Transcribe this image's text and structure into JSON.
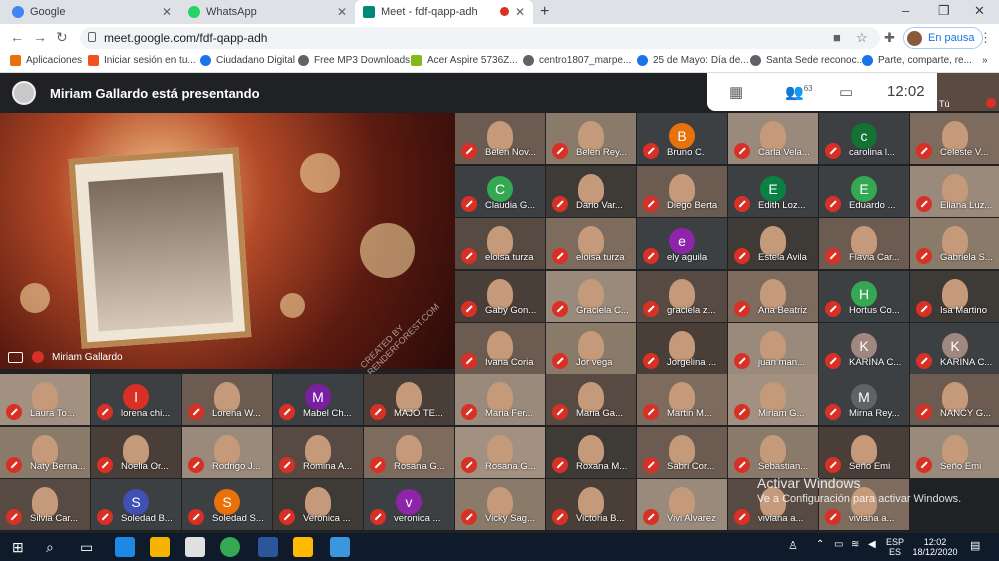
{
  "browser": {
    "tabs": [
      {
        "label": "Google",
        "icon": "google-icon",
        "color": "#4285f4"
      },
      {
        "label": "WhatsApp",
        "icon": "whatsapp-icon",
        "color": "#25d366"
      },
      {
        "label": "Meet - fdf-qapp-adh",
        "icon": "meet-icon",
        "color": "#00897b"
      }
    ],
    "url": "meet.google.com/fdf-qapp-adh",
    "profile_status": "En pausa",
    "bookmarks": [
      "Aplicaciones",
      "Iniciar sesión en tu...",
      "Ciudadano Digital",
      "Free MP3 Downloads",
      "Acer Aspire 5736Z...",
      "centro1807_marpe...",
      "25 de Mayo: Día de...",
      "Santa Sede reconoc...",
      "Parte, comparte, re..."
    ]
  },
  "meet": {
    "presenting_text": "Miriam Gallardo está presentando",
    "participants_count": "63",
    "clock": "12:02",
    "self_label": "Tú",
    "presenter_name": "Miriam Gallardo",
    "watermark": "CREATED BY RENDERFOREST.COM",
    "accent_red": "#d93025"
  },
  "participants": [
    {
      "name": "Belen Nov...",
      "letter": ""
    },
    {
      "name": "Belen Rey...",
      "letter": ""
    },
    {
      "name": "Bruno C.",
      "letter": "B",
      "color": "#e8710a"
    },
    {
      "name": "Carla Vela...",
      "letter": ""
    },
    {
      "name": "carolina l...",
      "letter": "c",
      "color": "#137333"
    },
    {
      "name": "Celeste V...",
      "letter": ""
    },
    {
      "name": "Claudia G...",
      "letter": "C",
      "color": "#34a853"
    },
    {
      "name": "Dario Var...",
      "letter": ""
    },
    {
      "name": "Diego Berta",
      "letter": ""
    },
    {
      "name": "Edith Loz...",
      "letter": "E",
      "color": "#0b8043"
    },
    {
      "name": "Eduardo ...",
      "letter": "E",
      "color": "#34a853"
    },
    {
      "name": "Eliana Luz...",
      "letter": ""
    },
    {
      "name": "eloisa turza",
      "letter": ""
    },
    {
      "name": "eloisa turza",
      "letter": ""
    },
    {
      "name": "ely aguila",
      "letter": "e",
      "color": "#8e24aa"
    },
    {
      "name": "Estela Avila",
      "letter": ""
    },
    {
      "name": "Flavia Car...",
      "letter": ""
    },
    {
      "name": "Gabriela S...",
      "letter": ""
    },
    {
      "name": "Gaby Gon...",
      "letter": ""
    },
    {
      "name": "Graciela C...",
      "letter": ""
    },
    {
      "name": "graciela z...",
      "letter": ""
    },
    {
      "name": "Ana Beatriz",
      "letter": ""
    },
    {
      "name": "Hortus Co...",
      "letter": "H",
      "color": "#34a853"
    },
    {
      "name": "Isa Martino",
      "letter": ""
    },
    {
      "name": "Ivana Coria",
      "letter": ""
    },
    {
      "name": "Jor vega",
      "letter": ""
    },
    {
      "name": "Jorgelina ...",
      "letter": ""
    },
    {
      "name": "juan man...",
      "letter": ""
    },
    {
      "name": "KARINA C...",
      "letter": "K",
      "color": "#a1887f"
    },
    {
      "name": "KARINA C...",
      "letter": "K",
      "color": "#a1887f"
    },
    {
      "name": "Laura To...",
      "letter": ""
    },
    {
      "name": "lorena chi...",
      "letter": "l",
      "color": "#d93025"
    },
    {
      "name": "Lorena W...",
      "letter": ""
    },
    {
      "name": "Mabel Ch...",
      "letter": "M",
      "color": "#7b1fa2"
    },
    {
      "name": "MAJO TE...",
      "letter": ""
    },
    {
      "name": "Maria Fer...",
      "letter": ""
    },
    {
      "name": "Maria Ga...",
      "letter": ""
    },
    {
      "name": "Martin M...",
      "letter": ""
    },
    {
      "name": "Miriam G...",
      "letter": ""
    },
    {
      "name": "Mirna Rey...",
      "letter": "M",
      "color": "#5f6368"
    },
    {
      "name": "NANCY G...",
      "letter": ""
    },
    {
      "name": "Naty Berna...",
      "letter": ""
    },
    {
      "name": "Noelia Or...",
      "letter": ""
    },
    {
      "name": "Rodrigo J...",
      "letter": ""
    },
    {
      "name": "Romina A...",
      "letter": ""
    },
    {
      "name": "Rosana G...",
      "letter": ""
    },
    {
      "name": "Rosana G...",
      "letter": ""
    },
    {
      "name": "Roxana M...",
      "letter": ""
    },
    {
      "name": "Sabri Cor...",
      "letter": ""
    },
    {
      "name": "Sebastian...",
      "letter": ""
    },
    {
      "name": "Seño Emi",
      "letter": ""
    },
    {
      "name": "Seño Emi",
      "letter": ""
    },
    {
      "name": "Silvia Car...",
      "letter": ""
    },
    {
      "name": "Soledad B...",
      "letter": "S",
      "color": "#3f51b5"
    },
    {
      "name": "Soledad S...",
      "letter": "S",
      "color": "#e8710a"
    },
    {
      "name": "Verónica ...",
      "letter": ""
    },
    {
      "name": "veronica ...",
      "letter": "v",
      "color": "#8e24aa"
    },
    {
      "name": "Vicky Sag...",
      "letter": ""
    },
    {
      "name": "Victoria B...",
      "letter": ""
    },
    {
      "name": "Vivi Alvarez",
      "letter": ""
    },
    {
      "name": "viviana a...",
      "letter": ""
    },
    {
      "name": "viviana a...",
      "letter": ""
    }
  ],
  "activation": {
    "title": "Activar Windows",
    "subtitle": "Ve a Configuración para activar Windows."
  },
  "taskbar": {
    "lang_top": "ESP",
    "lang_bottom": "ES",
    "time": "12:02",
    "date": "18/12/2020"
  }
}
